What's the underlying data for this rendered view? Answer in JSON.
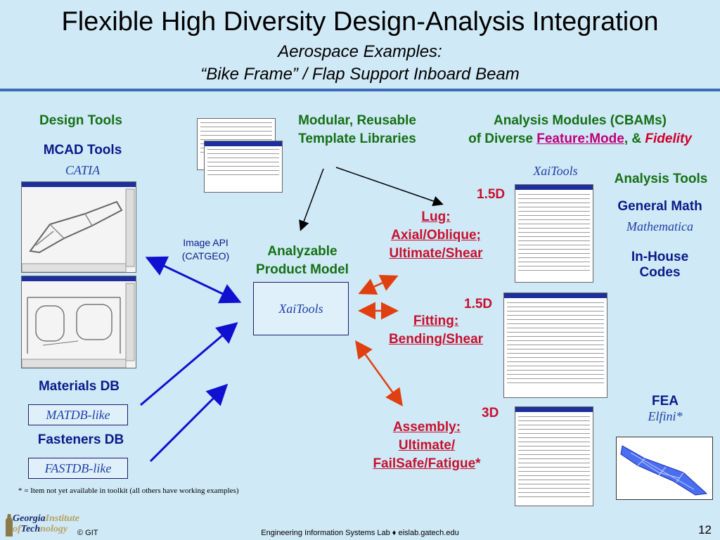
{
  "title": {
    "line1": "Flexible High Diversity Design-Analysis Integration",
    "line2": "Aerospace Examples:",
    "line3": "“Bike Frame” / Flap Support Inboard Beam"
  },
  "design_tools": {
    "heading": "Design Tools",
    "mcad_heading": "MCAD Tools",
    "mcad_tool": "CATIA",
    "materials_heading": "Materials DB",
    "materials_tool": "MATDB-like",
    "fasteners_heading": "Fasteners DB",
    "fasteners_tool": "FASTDB-like"
  },
  "image_api": {
    "line1": "Image API",
    "line2": "(CATGEO)"
  },
  "templates": {
    "line1": "Modular, Reusable",
    "line2": "Template Libraries"
  },
  "product_model": {
    "line1": "Analyzable",
    "line2": "Product Model",
    "tool": "XaiTools"
  },
  "analysis_modules": {
    "line1": "Analysis Modules (CBAMs)",
    "line2_prefix": "of Diverse ",
    "feature_mode": "Feature:Mode",
    "sep": ", & ",
    "fidelity": "Fidelity",
    "tool": "XaiTools"
  },
  "modules": [
    {
      "dim": "1.5D",
      "line1": "Lug:",
      "line2": "Axial/Oblique;",
      "line3": "Ultimate/Shear"
    },
    {
      "dim": "1.5D",
      "line1": "Fitting:",
      "line2": "Bending/Shear"
    },
    {
      "dim": "3D",
      "line1": "Assembly:",
      "line2": "Ultimate/",
      "line3": "FailSafe/Fatigue",
      "star": "*"
    }
  ],
  "analysis_tools": {
    "heading": "Analysis Tools",
    "general_math": "General Math",
    "general_math_tool": "Mathematica",
    "inhouse_line1": "In-House",
    "inhouse_line2": "Codes",
    "fea": "FEA",
    "fea_tool": "Elfini*"
  },
  "footnote": "* = Item not yet available in toolkit (all others have working examples)",
  "footer": {
    "copyright": "© GIT",
    "lab": "Engineering Information Systems Lab ♦ eislab.gatech.edu",
    "page": "12",
    "logo_line1a": "Georgia",
    "logo_line1b": "Institute",
    "logo_line2a": "of",
    "logo_line2b": "Tech",
    "logo_line2c": "nology"
  },
  "colors": {
    "background": "#cfe9f6",
    "title_rule": "#3a6fb5",
    "green_heading": "#157015",
    "navy_text": "#0a1a8a",
    "red_text": "#c8102e",
    "blue_arrow": "#1010d0",
    "orange_arrow": "#e04010"
  }
}
